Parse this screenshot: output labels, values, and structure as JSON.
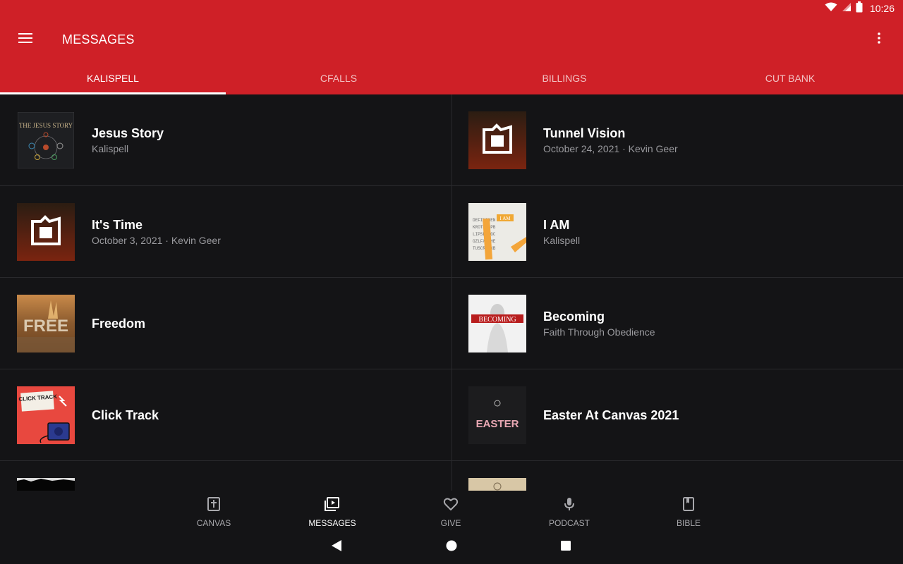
{
  "status_bar": {
    "time": "10:26"
  },
  "app_bar": {
    "title": "MESSAGES"
  },
  "tabs": [
    {
      "label": "KALISPELL",
      "active": true
    },
    {
      "label": "CFALLS",
      "active": false
    },
    {
      "label": "BILLINGS",
      "active": false
    },
    {
      "label": "CUT BANK",
      "active": false
    }
  ],
  "messages": [
    {
      "title": "Jesus Story",
      "subtitle": "Kalispell",
      "thumb_text": "THE JESUS STORY"
    },
    {
      "title": "Tunnel Vision",
      "subtitle": "October 24, 2021 · Kevin Geer"
    },
    {
      "title": "It's Time",
      "subtitle": "October 3, 2021 · Kevin Geer"
    },
    {
      "title": "I AM",
      "subtitle": "Kalispell",
      "thumb_text": "I AM"
    },
    {
      "title": "Freedom",
      "subtitle": "",
      "thumb_text": "FREE"
    },
    {
      "title": "Becoming",
      "subtitle": "Faith Through Obedience",
      "thumb_text": "BECOMING"
    },
    {
      "title": "Click Track",
      "subtitle": "",
      "thumb_text": "CLICK TRACK"
    },
    {
      "title": "Easter At Canvas 2021",
      "subtitle": "",
      "thumb_text": "EASTER"
    }
  ],
  "bottom_nav": [
    {
      "label": "CANVAS",
      "icon": "cross-book-icon",
      "active": false
    },
    {
      "label": "MESSAGES",
      "icon": "video-library-icon",
      "active": true
    },
    {
      "label": "GIVE",
      "icon": "heart-icon",
      "active": false
    },
    {
      "label": "PODCAST",
      "icon": "microphone-icon",
      "active": false
    },
    {
      "label": "BIBLE",
      "icon": "book-icon",
      "active": false
    }
  ],
  "colors": {
    "accent": "#cf2027",
    "background": "#141416",
    "divider": "#2a2a2d",
    "subtitle": "#9a9a9e"
  }
}
